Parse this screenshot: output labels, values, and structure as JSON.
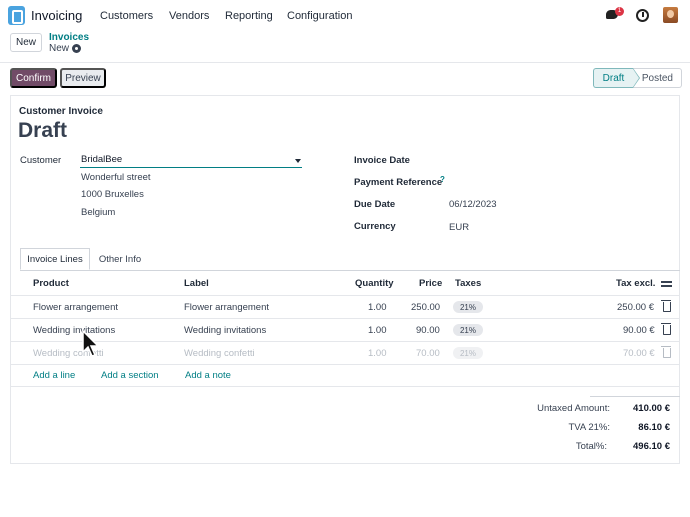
{
  "nav": {
    "app_name": "Invoicing",
    "menu": [
      "Customers",
      "Vendors",
      "Reporting",
      "Configuration"
    ],
    "chat_badge": "1",
    "icons": {
      "app": "invoicing-app-icon",
      "chat": "chat-icon",
      "clock": "clock-icon"
    }
  },
  "breadcrumb": {
    "new_label": "New",
    "parent": "Invoices",
    "current": "New"
  },
  "actions": {
    "confirm": "Confirm",
    "preview": "Preview"
  },
  "status": {
    "steps": [
      "Draft",
      "Posted"
    ],
    "active": "Draft"
  },
  "form": {
    "doc_type": "Customer Invoice",
    "state": "Draft",
    "customer_label": "Customer",
    "customer_value": "BridalBee",
    "address": [
      "Wonderful street",
      "1000 Bruxelles",
      "Belgium"
    ],
    "invoice_date_label": "Invoice Date",
    "payment_ref_label": "Payment Reference",
    "help_mark": "?",
    "due_date_label": "Due Date",
    "due_date_value": "06/12/2023",
    "currency_label": "Currency",
    "currency_value": "EUR"
  },
  "tabs": [
    "Invoice Lines",
    "Other Info"
  ],
  "table": {
    "headers": [
      "Product",
      "Label",
      "Quantity",
      "Price",
      "Taxes",
      "Tax excl."
    ],
    "rows": [
      {
        "product": "Flower arrangement",
        "label": "Flower arrangement",
        "quantity": "1.00",
        "price": "250.00",
        "tax": "21%",
        "total": "250.00 €"
      },
      {
        "product": "Wedding invitations",
        "label": "Wedding invitations",
        "quantity": "1.00",
        "price": "90.00",
        "tax": "21%",
        "total": "90.00 €"
      },
      {
        "product": "Wedding confetti",
        "label": "Wedding confetti",
        "quantity": "1.00",
        "price": "70.00",
        "tax": "21%",
        "total": "70.00 €"
      }
    ],
    "add_links": [
      "Add a line",
      "Add a section",
      "Add a note"
    ]
  },
  "totals": {
    "untaxed_label": "Untaxed Amount:",
    "untaxed_value": "410.00 €",
    "tva_label": "TVA 21%:",
    "tva_value": "86.10 €",
    "total_label": "Total%:",
    "total_value": "496.10 €"
  },
  "colors": {
    "primary": "#714b67",
    "link": "#017e84"
  }
}
